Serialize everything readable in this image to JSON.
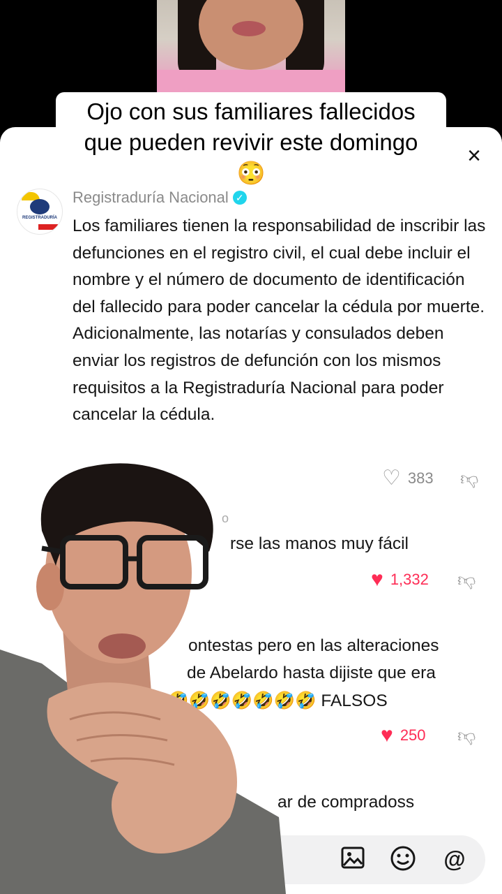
{
  "caption": {
    "line1": "Ojo con sus familiares fallecidos",
    "line2": "que pueden revivir este domingo",
    "emoji": "😳"
  },
  "comment_sheet": {
    "close_icon": "×"
  },
  "top_comment": {
    "username": "Registraduría Nacional",
    "verified_icon": "✓",
    "avatar_text": "REGISTRADURÍA",
    "text": "Los familiares tienen la responsabilidad de inscribir las defunciones en el registro civil, el cual debe incluir el nombre y el número de documento de identificación del fallecido para poder cancelar la cédula por muerte. Adicionalmente, las notarías y consulados deben enviar los registros de defunción con los mismos requisitos a la Registraduría Nacional para poder cancelar la cédula.",
    "likes": "383"
  },
  "comments": [
    {
      "username_partial": "o",
      "text_partial": "rse las manos muy fácil",
      "likes": "1,332"
    },
    {
      "text_partial_1": "ontestas pero en las alteraciones",
      "text_partial_2": "de Abelardo hasta dijiste que era",
      "text_partial_3": "🤣🤣🤣🤣🤣🤣🤣 FALSOS",
      "likes": "250"
    },
    {
      "text_partial": "ar de compradoss"
    }
  ],
  "input_bar": {
    "image_icon": "image-icon",
    "emoji_icon": "emoji-icon",
    "mention_label": "@"
  },
  "colors": {
    "like_pink": "#fe2c55",
    "verified_blue": "#20d5ec",
    "meta_grey": "#8a8a8a"
  }
}
